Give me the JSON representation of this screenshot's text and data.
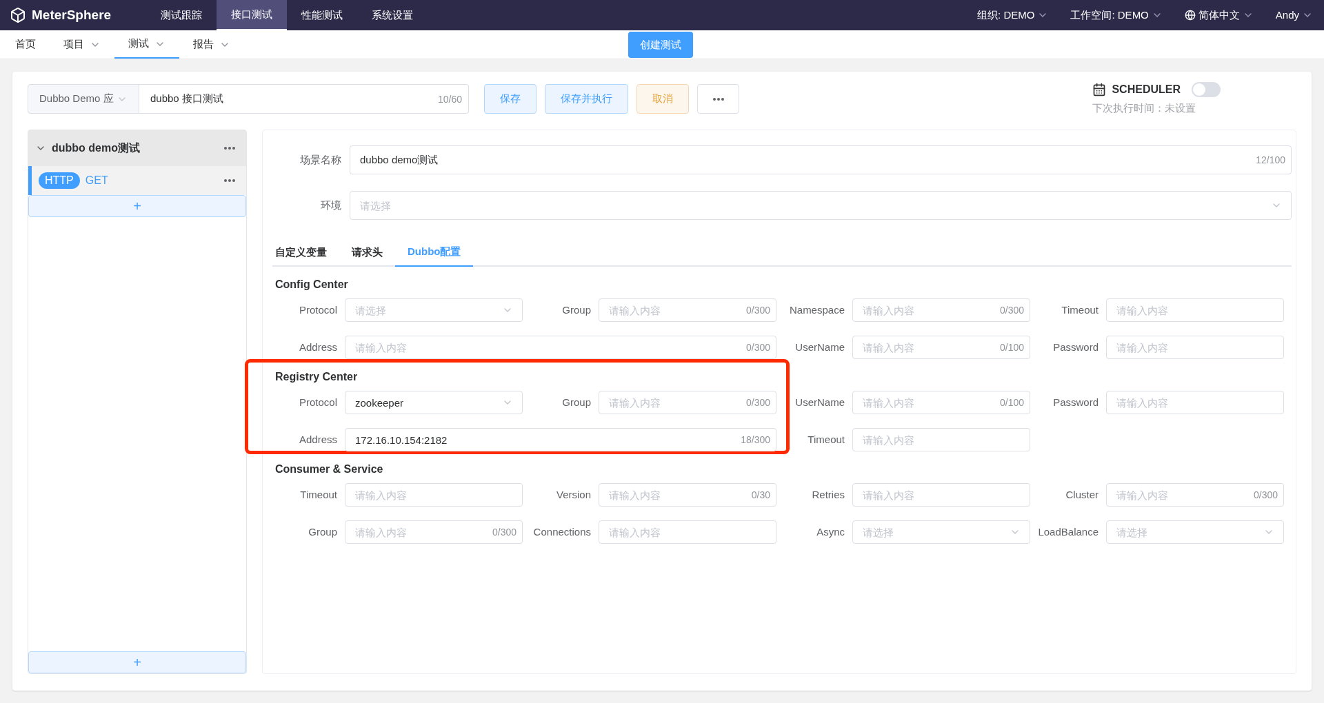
{
  "app": {
    "logo": "MeterSphere"
  },
  "top_nav": [
    {
      "label": "测试跟踪",
      "selected": false
    },
    {
      "label": "接口测试",
      "selected": true
    },
    {
      "label": "性能测试",
      "selected": false
    },
    {
      "label": "系统设置",
      "selected": false
    }
  ],
  "top_right": [
    {
      "label": "组织: DEMO",
      "kind": "menu"
    },
    {
      "label": "工作空间: DEMO",
      "kind": "menu"
    },
    {
      "label": "简体中文",
      "kind": "language"
    },
    {
      "label": "Andy",
      "kind": "menu"
    }
  ],
  "sub_nav": [
    {
      "label": "首页",
      "dropdown": false,
      "selected": false
    },
    {
      "label": "项目",
      "dropdown": true,
      "selected": false
    },
    {
      "label": "测试",
      "dropdown": true,
      "selected": true
    },
    {
      "label": "报告",
      "dropdown": true,
      "selected": false
    }
  ],
  "create_button": "创建测试",
  "toolbar": {
    "project_select": "Dubbo Demo 应",
    "name_value": "dubbo 接口测试",
    "name_counter": "10/60",
    "buttons": [
      {
        "label": "保存",
        "kind": "primary"
      },
      {
        "label": "保存并执行",
        "kind": "primary"
      },
      {
        "label": "取消",
        "kind": "warning"
      },
      {
        "kind": "more"
      }
    ],
    "scheduler": {
      "label": "SCHEDULER",
      "on": false
    },
    "next_run": "下次执行时间：未设置"
  },
  "scenario_tree": {
    "scenario": {
      "name": "dubbo demo测试",
      "expanded": true
    },
    "requests": [
      {
        "protocol": "HTTP",
        "name": "GET",
        "selected": true
      }
    ],
    "add": "+",
    "bottom_add": "+"
  },
  "form": {
    "scenario_name": {
      "label": "场景名称",
      "value": "dubbo demo测试",
      "counter": "12/100"
    },
    "environment": {
      "label": "环境",
      "placeholder": "请选择"
    },
    "tabs": [
      {
        "label": "自定义变量",
        "selected": false
      },
      {
        "label": "请求头",
        "selected": false
      },
      {
        "label": "Dubbo配置",
        "selected": true
      }
    ],
    "sections": [
      {
        "title": "Config Center",
        "highlighted": false,
        "fields": [
          {
            "label": "Protocol",
            "kind": "select",
            "wide": false,
            "placeholder": "请选择"
          },
          {
            "label": "Group",
            "kind": "input",
            "wide": false,
            "placeholder": "请输入内容",
            "counter": "0/300"
          },
          {
            "label": "Namespace",
            "kind": "input",
            "wide": false,
            "placeholder": "请输入内容",
            "counter": "0/300"
          },
          {
            "label": "Timeout",
            "kind": "input",
            "wide": false,
            "placeholder": "请输入内容"
          },
          {
            "label": "Address",
            "kind": "input",
            "wide": true,
            "placeholder": "请输入内容",
            "counter": "0/300"
          },
          {
            "label": "UserName",
            "kind": "input",
            "wide": false,
            "placeholder": "请输入内容",
            "counter": "0/100"
          },
          {
            "label": "Password",
            "kind": "input",
            "wide": false,
            "placeholder": "请输入内容"
          }
        ]
      },
      {
        "title": "Registry Center",
        "highlighted": true,
        "fields": [
          {
            "label": "Protocol",
            "kind": "select",
            "wide": false,
            "value": "zookeeper"
          },
          {
            "label": "Group",
            "kind": "input",
            "wide": false,
            "placeholder": "请输入内容",
            "counter": "0/300"
          },
          {
            "label": "UserName",
            "kind": "input",
            "wide": false,
            "placeholder": "请输入内容",
            "counter": "0/100"
          },
          {
            "label": "Password",
            "kind": "input",
            "wide": false,
            "placeholder": "请输入内容"
          },
          {
            "label": "Address",
            "kind": "input",
            "wide": true,
            "value": "172.16.10.154:2182",
            "counter": "18/300"
          },
          {
            "label": "Timeout",
            "kind": "input",
            "wide": false,
            "placeholder": "请输入内容"
          }
        ]
      },
      {
        "title": "Consumer & Service",
        "highlighted": false,
        "fields": [
          {
            "label": "Timeout",
            "kind": "input",
            "wide": false,
            "placeholder": "请输入内容"
          },
          {
            "label": "Version",
            "kind": "input",
            "wide": false,
            "placeholder": "请输入内容",
            "counter": "0/30"
          },
          {
            "label": "Retries",
            "kind": "input",
            "wide": false,
            "placeholder": "请输入内容"
          },
          {
            "label": "Cluster",
            "kind": "input",
            "wide": false,
            "placeholder": "请输入内容",
            "counter": "0/300"
          },
          {
            "label": "Group",
            "kind": "input",
            "wide": false,
            "placeholder": "请输入内容",
            "counter": "0/300"
          },
          {
            "label": "Connections",
            "kind": "input",
            "wide": false,
            "placeholder": "请输入内容"
          },
          {
            "label": "Async",
            "kind": "select",
            "wide": false,
            "placeholder": "请选择"
          },
          {
            "label": "LoadBalance",
            "kind": "select",
            "wide": false,
            "placeholder": "请选择"
          }
        ]
      }
    ]
  }
}
